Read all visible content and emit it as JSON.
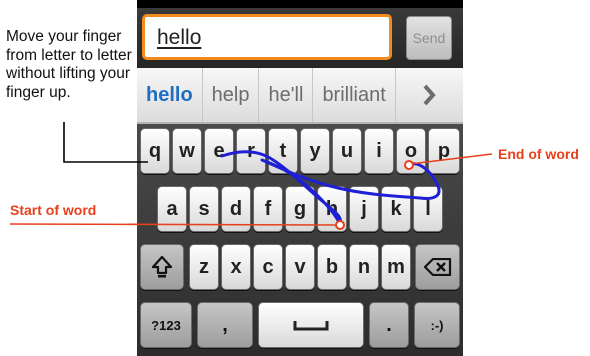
{
  "annotations": {
    "instructions": "Move your finger from letter to letter without lifting your finger up.",
    "end_label": "End of word",
    "start_label": "Start of word"
  },
  "compose": {
    "text_value": "hello",
    "send_label": "Send"
  },
  "suggestions": [
    "hello",
    "help",
    "he'll",
    "brilliant"
  ],
  "more_icon": "chevron-right-icon",
  "keyboard": {
    "row1": [
      "q",
      "w",
      "e",
      "r",
      "t",
      "y",
      "u",
      "i",
      "o",
      "p"
    ],
    "row2": [
      "a",
      "s",
      "d",
      "f",
      "g",
      "h",
      "j",
      "k",
      "l"
    ],
    "row3": [
      "z",
      "x",
      "c",
      "v",
      "b",
      "n",
      "m"
    ],
    "symbols_label": "?123",
    "comma_label": ",",
    "period_label": ".",
    "smiley_label": ":-)",
    "shift_icon": "shift-icon",
    "backspace_icon": "backspace-icon",
    "space_icon": "space-icon"
  },
  "colors": {
    "accent_orange": "#f28b1d",
    "suggestion_blue": "#1e6fc3",
    "gesture_trace": "#1f1fd6",
    "annotation_red": "#e8401c"
  }
}
